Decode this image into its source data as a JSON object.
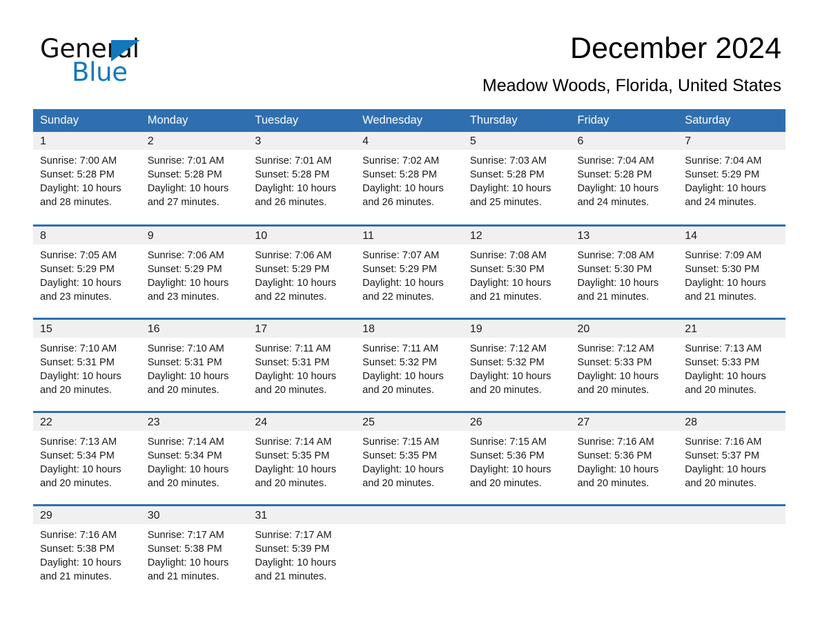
{
  "logo": {
    "word_one": "General",
    "word_two": "Blue",
    "triangle_color": "#1278be",
    "text_color": "#111111"
  },
  "header": {
    "title": "December 2024",
    "subtitle": "Meadow Woods, Florida, United States"
  },
  "colors": {
    "header_blue": "#2f6fb0",
    "row_divider_blue": "#2f6fb0",
    "daynum_band": "#f0f0f0",
    "text": "#1a1a1a",
    "page_background": "#ffffff"
  },
  "calendar": {
    "weekdays": [
      "Sunday",
      "Monday",
      "Tuesday",
      "Wednesday",
      "Thursday",
      "Friday",
      "Saturday"
    ],
    "weeks": [
      [
        {
          "day": "1",
          "sunrise": "Sunrise: 7:00 AM",
          "sunset": "Sunset: 5:28 PM",
          "daylight_1": "Daylight: 10 hours",
          "daylight_2": "and 28 minutes."
        },
        {
          "day": "2",
          "sunrise": "Sunrise: 7:01 AM",
          "sunset": "Sunset: 5:28 PM",
          "daylight_1": "Daylight: 10 hours",
          "daylight_2": "and 27 minutes."
        },
        {
          "day": "3",
          "sunrise": "Sunrise: 7:01 AM",
          "sunset": "Sunset: 5:28 PM",
          "daylight_1": "Daylight: 10 hours",
          "daylight_2": "and 26 minutes."
        },
        {
          "day": "4",
          "sunrise": "Sunrise: 7:02 AM",
          "sunset": "Sunset: 5:28 PM",
          "daylight_1": "Daylight: 10 hours",
          "daylight_2": "and 26 minutes."
        },
        {
          "day": "5",
          "sunrise": "Sunrise: 7:03 AM",
          "sunset": "Sunset: 5:28 PM",
          "daylight_1": "Daylight: 10 hours",
          "daylight_2": "and 25 minutes."
        },
        {
          "day": "6",
          "sunrise": "Sunrise: 7:04 AM",
          "sunset": "Sunset: 5:28 PM",
          "daylight_1": "Daylight: 10 hours",
          "daylight_2": "and 24 minutes."
        },
        {
          "day": "7",
          "sunrise": "Sunrise: 7:04 AM",
          "sunset": "Sunset: 5:29 PM",
          "daylight_1": "Daylight: 10 hours",
          "daylight_2": "and 24 minutes."
        }
      ],
      [
        {
          "day": "8",
          "sunrise": "Sunrise: 7:05 AM",
          "sunset": "Sunset: 5:29 PM",
          "daylight_1": "Daylight: 10 hours",
          "daylight_2": "and 23 minutes."
        },
        {
          "day": "9",
          "sunrise": "Sunrise: 7:06 AM",
          "sunset": "Sunset: 5:29 PM",
          "daylight_1": "Daylight: 10 hours",
          "daylight_2": "and 23 minutes."
        },
        {
          "day": "10",
          "sunrise": "Sunrise: 7:06 AM",
          "sunset": "Sunset: 5:29 PM",
          "daylight_1": "Daylight: 10 hours",
          "daylight_2": "and 22 minutes."
        },
        {
          "day": "11",
          "sunrise": "Sunrise: 7:07 AM",
          "sunset": "Sunset: 5:29 PM",
          "daylight_1": "Daylight: 10 hours",
          "daylight_2": "and 22 minutes."
        },
        {
          "day": "12",
          "sunrise": "Sunrise: 7:08 AM",
          "sunset": "Sunset: 5:30 PM",
          "daylight_1": "Daylight: 10 hours",
          "daylight_2": "and 21 minutes."
        },
        {
          "day": "13",
          "sunrise": "Sunrise: 7:08 AM",
          "sunset": "Sunset: 5:30 PM",
          "daylight_1": "Daylight: 10 hours",
          "daylight_2": "and 21 minutes."
        },
        {
          "day": "14",
          "sunrise": "Sunrise: 7:09 AM",
          "sunset": "Sunset: 5:30 PM",
          "daylight_1": "Daylight: 10 hours",
          "daylight_2": "and 21 minutes."
        }
      ],
      [
        {
          "day": "15",
          "sunrise": "Sunrise: 7:10 AM",
          "sunset": "Sunset: 5:31 PM",
          "daylight_1": "Daylight: 10 hours",
          "daylight_2": "and 20 minutes."
        },
        {
          "day": "16",
          "sunrise": "Sunrise: 7:10 AM",
          "sunset": "Sunset: 5:31 PM",
          "daylight_1": "Daylight: 10 hours",
          "daylight_2": "and 20 minutes."
        },
        {
          "day": "17",
          "sunrise": "Sunrise: 7:11 AM",
          "sunset": "Sunset: 5:31 PM",
          "daylight_1": "Daylight: 10 hours",
          "daylight_2": "and 20 minutes."
        },
        {
          "day": "18",
          "sunrise": "Sunrise: 7:11 AM",
          "sunset": "Sunset: 5:32 PM",
          "daylight_1": "Daylight: 10 hours",
          "daylight_2": "and 20 minutes."
        },
        {
          "day": "19",
          "sunrise": "Sunrise: 7:12 AM",
          "sunset": "Sunset: 5:32 PM",
          "daylight_1": "Daylight: 10 hours",
          "daylight_2": "and 20 minutes."
        },
        {
          "day": "20",
          "sunrise": "Sunrise: 7:12 AM",
          "sunset": "Sunset: 5:33 PM",
          "daylight_1": "Daylight: 10 hours",
          "daylight_2": "and 20 minutes."
        },
        {
          "day": "21",
          "sunrise": "Sunrise: 7:13 AM",
          "sunset": "Sunset: 5:33 PM",
          "daylight_1": "Daylight: 10 hours",
          "daylight_2": "and 20 minutes."
        }
      ],
      [
        {
          "day": "22",
          "sunrise": "Sunrise: 7:13 AM",
          "sunset": "Sunset: 5:34 PM",
          "daylight_1": "Daylight: 10 hours",
          "daylight_2": "and 20 minutes."
        },
        {
          "day": "23",
          "sunrise": "Sunrise: 7:14 AM",
          "sunset": "Sunset: 5:34 PM",
          "daylight_1": "Daylight: 10 hours",
          "daylight_2": "and 20 minutes."
        },
        {
          "day": "24",
          "sunrise": "Sunrise: 7:14 AM",
          "sunset": "Sunset: 5:35 PM",
          "daylight_1": "Daylight: 10 hours",
          "daylight_2": "and 20 minutes."
        },
        {
          "day": "25",
          "sunrise": "Sunrise: 7:15 AM",
          "sunset": "Sunset: 5:35 PM",
          "daylight_1": "Daylight: 10 hours",
          "daylight_2": "and 20 minutes."
        },
        {
          "day": "26",
          "sunrise": "Sunrise: 7:15 AM",
          "sunset": "Sunset: 5:36 PM",
          "daylight_1": "Daylight: 10 hours",
          "daylight_2": "and 20 minutes."
        },
        {
          "day": "27",
          "sunrise": "Sunrise: 7:16 AM",
          "sunset": "Sunset: 5:36 PM",
          "daylight_1": "Daylight: 10 hours",
          "daylight_2": "and 20 minutes."
        },
        {
          "day": "28",
          "sunrise": "Sunrise: 7:16 AM",
          "sunset": "Sunset: 5:37 PM",
          "daylight_1": "Daylight: 10 hours",
          "daylight_2": "and 20 minutes."
        }
      ],
      [
        {
          "day": "29",
          "sunrise": "Sunrise: 7:16 AM",
          "sunset": "Sunset: 5:38 PM",
          "daylight_1": "Daylight: 10 hours",
          "daylight_2": "and 21 minutes."
        },
        {
          "day": "30",
          "sunrise": "Sunrise: 7:17 AM",
          "sunset": "Sunset: 5:38 PM",
          "daylight_1": "Daylight: 10 hours",
          "daylight_2": "and 21 minutes."
        },
        {
          "day": "31",
          "sunrise": "Sunrise: 7:17 AM",
          "sunset": "Sunset: 5:39 PM",
          "daylight_1": "Daylight: 10 hours",
          "daylight_2": "and 21 minutes."
        },
        {
          "day": "",
          "sunrise": "",
          "sunset": "",
          "daylight_1": "",
          "daylight_2": ""
        },
        {
          "day": "",
          "sunrise": "",
          "sunset": "",
          "daylight_1": "",
          "daylight_2": ""
        },
        {
          "day": "",
          "sunrise": "",
          "sunset": "",
          "daylight_1": "",
          "daylight_2": ""
        },
        {
          "day": "",
          "sunrise": "",
          "sunset": "",
          "daylight_1": "",
          "daylight_2": ""
        }
      ]
    ]
  }
}
